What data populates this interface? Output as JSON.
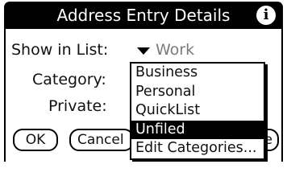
{
  "dialog": {
    "title": "Address Entry Details",
    "info_icon": "info-icon"
  },
  "fields": {
    "show_in_list_label": "Show in List:",
    "show_in_list_value": "Work",
    "category_label": "Category:",
    "private_label": "Private:"
  },
  "popup": {
    "items": [
      {
        "label": "Business",
        "selected": false
      },
      {
        "label": "Personal",
        "selected": false
      },
      {
        "label": "QuickList",
        "selected": false
      },
      {
        "label": "Unfiled",
        "selected": true
      },
      {
        "label": "Edit Categories...",
        "selected": false
      }
    ]
  },
  "buttons": {
    "ok": "OK",
    "cancel": "Cancel",
    "note": "e"
  }
}
